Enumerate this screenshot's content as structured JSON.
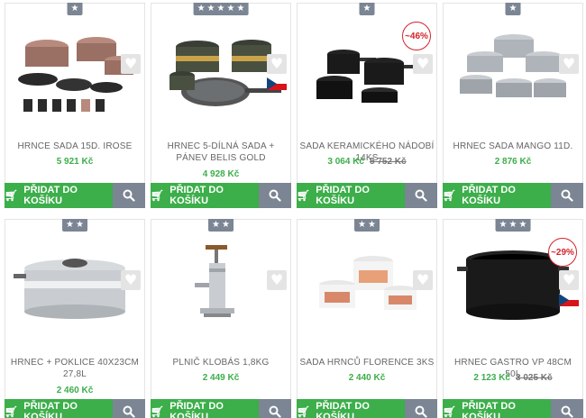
{
  "products": [
    {
      "title": "HRNCE SADA 15D. IROSE",
      "price": "5 921 Kč",
      "old_price": "",
      "discount": "",
      "stars": 1,
      "flag": false
    },
    {
      "title": "HRNEC 5-DÍLNÁ SADA + PÁNEV BELIS GOLD",
      "price": "4 928 Kč",
      "old_price": "",
      "discount": "",
      "stars": 5,
      "flag": true
    },
    {
      "title": "SADA KERAMICKÉHO NÁDOBÍ 14KS",
      "price": "3 064 Kč",
      "old_price": "5 752 Kč",
      "discount": "~46%",
      "stars": 1,
      "flag": false
    },
    {
      "title": "HRNEC SADA MANGO 11D.",
      "price": "2 876 Kč",
      "old_price": "",
      "discount": "",
      "stars": 1,
      "flag": false
    },
    {
      "title": "HRNEC + POKLICE 40X23CM 27,8L",
      "price": "2 460 Kč",
      "old_price": "",
      "discount": "",
      "stars": 2,
      "flag": false
    },
    {
      "title": "PLNIČ KLOBÁS 1,8KG",
      "price": "2 449 Kč",
      "old_price": "",
      "discount": "",
      "stars": 2,
      "flag": false
    },
    {
      "title": "SADA HRNCŮ FLORENCE 3KS",
      "price": "2 440 Kč",
      "old_price": "",
      "discount": "",
      "stars": 2,
      "flag": false
    },
    {
      "title": "HRNEC GASTRO VP 48CM 50L",
      "price": "2 123 Kč",
      "old_price": "3 025 Kč",
      "discount": "~29%",
      "stars": 3,
      "flag": true
    }
  ],
  "labels": {
    "add_to_cart": "PŘIDAT DO KOŠÍKU"
  },
  "icons": {
    "star": "star-icon",
    "heart": "heart-icon",
    "cart": "cart-icon",
    "search": "search-icon",
    "flag": "cz-flag-icon"
  },
  "colors": {
    "green": "#3cae4a",
    "gray_button": "#7b8593",
    "discount_red": "#d2232a"
  }
}
